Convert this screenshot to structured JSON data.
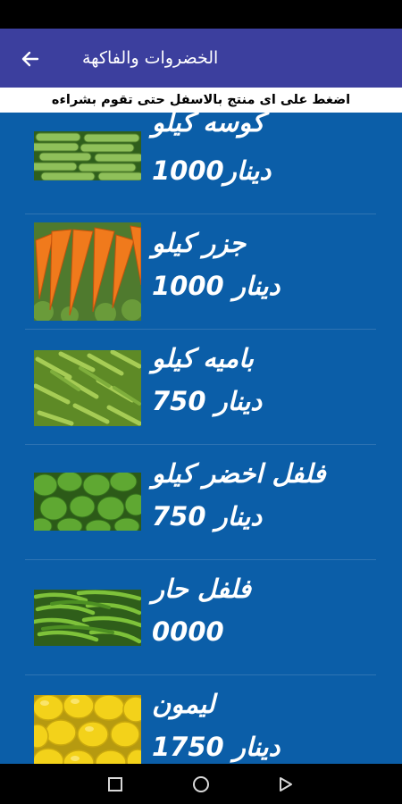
{
  "app_bar": {
    "title": "الخضروات والفاكهة",
    "back_icon": "arrow-back-icon"
  },
  "hint": "اضغط على اى منتج بالاسفل حتى تقوم بشراءه",
  "colors": {
    "app_bar": "#3c3f9e",
    "list_background": "#0b5ea8",
    "text": "#ffffff"
  },
  "products": [
    {
      "name": "كوسه كيلو",
      "price": "1000دينار",
      "image": "zucchini-image"
    },
    {
      "name": "جزر كيلو",
      "price": "1000 دينار",
      "image": "carrot-image"
    },
    {
      "name": "باميه كيلو",
      "price": "750 دينار",
      "image": "okra-image"
    },
    {
      "name": "فلفل اخضر كيلو",
      "price": "750 دينار",
      "image": "green-pepper-image"
    },
    {
      "name": "فلفل حار",
      "price": "0000",
      "image": "hot-pepper-image"
    },
    {
      "name": "ليمون",
      "price": "1750 دينار",
      "image": "lemon-image"
    }
  ],
  "nav_bar": {
    "icons": [
      "recent-apps-icon",
      "home-icon",
      "back-triangle-icon"
    ]
  }
}
